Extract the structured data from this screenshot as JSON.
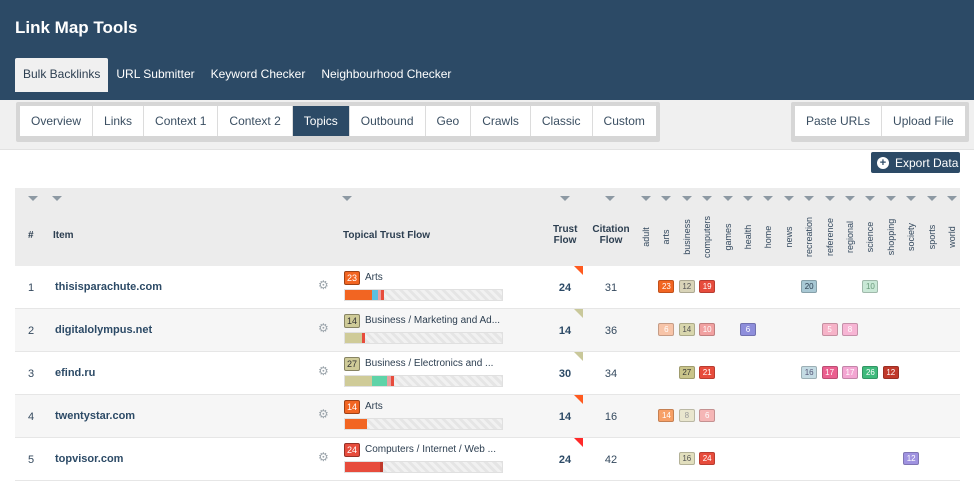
{
  "app": {
    "title": "Link Map Tools"
  },
  "main_tabs": [
    "Bulk Backlinks",
    "URL Submitter",
    "Keyword Checker",
    "Neighbourhood Checker"
  ],
  "sub_tabs": [
    "Overview",
    "Links",
    "Context 1",
    "Context 2",
    "Topics",
    "Outbound",
    "Geo",
    "Crawls",
    "Classic",
    "Custom"
  ],
  "actions": [
    "Paste URLs",
    "Upload File"
  ],
  "export_label": "Export Data",
  "columns": {
    "num": "#",
    "item": "Item",
    "ttf": "Topical Trust Flow",
    "trust_flow": [
      "Trust",
      "Flow"
    ],
    "citation_flow": [
      "Citation",
      "Flow"
    ],
    "topics": [
      "adult",
      "arts",
      "business",
      "computers",
      "games",
      "health",
      "home",
      "news",
      "recreation",
      "reference",
      "regional",
      "science",
      "shopping",
      "society",
      "sports",
      "world"
    ]
  },
  "rows": [
    {
      "num": "1",
      "item": "thisisparachute.com",
      "ttf_value": "23",
      "ttf_color": "#f26522",
      "ttf_label": "Arts",
      "trust_flow": "24",
      "citation_flow": "31",
      "flag_color": "#ff5a1f",
      "bar": [
        {
          "pct": 0.17,
          "color": "#f26522"
        },
        {
          "pct": 0.04,
          "color": "#5bc0de"
        },
        {
          "pct": 0.02,
          "color": "#e9a0a0"
        },
        {
          "pct": 0.02,
          "color": "#e74c3c"
        }
      ],
      "topics": [
        {
          "col": 1,
          "value": "23",
          "bg": "#f26522",
          "fg": "#fff"
        },
        {
          "col": 2,
          "value": "12",
          "bg": "#d9d4b8",
          "fg": "#555"
        },
        {
          "col": 3,
          "value": "19",
          "bg": "#e74c3c",
          "fg": "#fff"
        },
        {
          "col": 8,
          "value": "20",
          "bg": "#a8c8d4",
          "fg": "#2c3e50"
        },
        {
          "col": 11,
          "value": "10",
          "bg": "#c9e8d6",
          "fg": "#6a9a7a"
        }
      ]
    },
    {
      "num": "2",
      "item": "digitalolympus.net",
      "ttf_value": "14",
      "ttf_color": "#cfcb98",
      "ttf_label": "Business / Marketing and Ad...",
      "trust_flow": "14",
      "citation_flow": "36",
      "flag_color": "#c9c89a",
      "bar": [
        {
          "pct": 0.11,
          "color": "#cfcb98"
        },
        {
          "pct": 0.02,
          "color": "#e74c3c"
        }
      ],
      "topics": [
        {
          "col": 1,
          "value": "6",
          "bg": "#f7c4a8",
          "fg": "#fff"
        },
        {
          "col": 2,
          "value": "14",
          "bg": "#d8d6ad",
          "fg": "#555"
        },
        {
          "col": 3,
          "value": "10",
          "bg": "#f1a1a1",
          "fg": "#fff"
        },
        {
          "col": 5,
          "value": "6",
          "bg": "#8e8edb",
          "fg": "#fff"
        },
        {
          "col": 9,
          "value": "5",
          "bg": "#f6b3c8",
          "fg": "#fff"
        },
        {
          "col": 10,
          "value": "8",
          "bg": "#f7b5d4",
          "fg": "#fff"
        }
      ]
    },
    {
      "num": "3",
      "item": "efind.ru",
      "ttf_value": "27",
      "ttf_color": "#cfcb98",
      "ttf_label": "Business / Electronics and ...",
      "trust_flow": "30",
      "citation_flow": "34",
      "flag_color": "#c9c89a",
      "bar": [
        {
          "pct": 0.17,
          "color": "#cfcb98"
        },
        {
          "pct": 0.1,
          "color": "#5fd3a8"
        },
        {
          "pct": 0.02,
          "color": "#e9a0a0"
        },
        {
          "pct": 0.02,
          "color": "#e74c3c"
        }
      ],
      "topics": [
        {
          "col": 2,
          "value": "27",
          "bg": "#c9c48a",
          "fg": "#333"
        },
        {
          "col": 3,
          "value": "21",
          "bg": "#e74c3c",
          "fg": "#fff"
        },
        {
          "col": 8,
          "value": "16",
          "bg": "#c4dbe3",
          "fg": "#557"
        },
        {
          "col": 9,
          "value": "17",
          "bg": "#ea5f8f",
          "fg": "#fff"
        },
        {
          "col": 10,
          "value": "17",
          "bg": "#f3a5d2",
          "fg": "#fff"
        },
        {
          "col": 11,
          "value": "26",
          "bg": "#3fba7c",
          "fg": "#fff"
        },
        {
          "col": 12,
          "value": "12",
          "bg": "#c0392b",
          "fg": "#fff"
        }
      ]
    },
    {
      "num": "4",
      "item": "twentystar.com",
      "ttf_value": "14",
      "ttf_color": "#f26522",
      "ttf_label": "Arts",
      "trust_flow": "14",
      "citation_flow": "16",
      "flag_color": "#ff5a1f",
      "bar": [
        {
          "pct": 0.14,
          "color": "#f26522"
        }
      ],
      "topics": [
        {
          "col": 1,
          "value": "14",
          "bg": "#f7a067",
          "fg": "#fff"
        },
        {
          "col": 2,
          "value": "8",
          "bg": "#e9e6ce",
          "fg": "#999"
        },
        {
          "col": 3,
          "value": "6",
          "bg": "#f5b6b6",
          "fg": "#fff"
        }
      ]
    },
    {
      "num": "5",
      "item": "topvisor.com",
      "ttf_value": "24",
      "ttf_color": "#e74c3c",
      "ttf_label": "Computers / Internet / Web ...",
      "trust_flow": "24",
      "citation_flow": "42",
      "flag_color": "#ff2a2a",
      "bar": [
        {
          "pct": 0.22,
          "color": "#e74c3c"
        },
        {
          "pct": 0.02,
          "color": "#c0392b"
        }
      ],
      "topics": [
        {
          "col": 2,
          "value": "16",
          "bg": "#e2dfbe",
          "fg": "#555"
        },
        {
          "col": 3,
          "value": "24",
          "bg": "#e74c3c",
          "fg": "#fff"
        },
        {
          "col": 13,
          "value": "12",
          "bg": "#9f92e0",
          "fg": "#fff"
        }
      ]
    }
  ]
}
